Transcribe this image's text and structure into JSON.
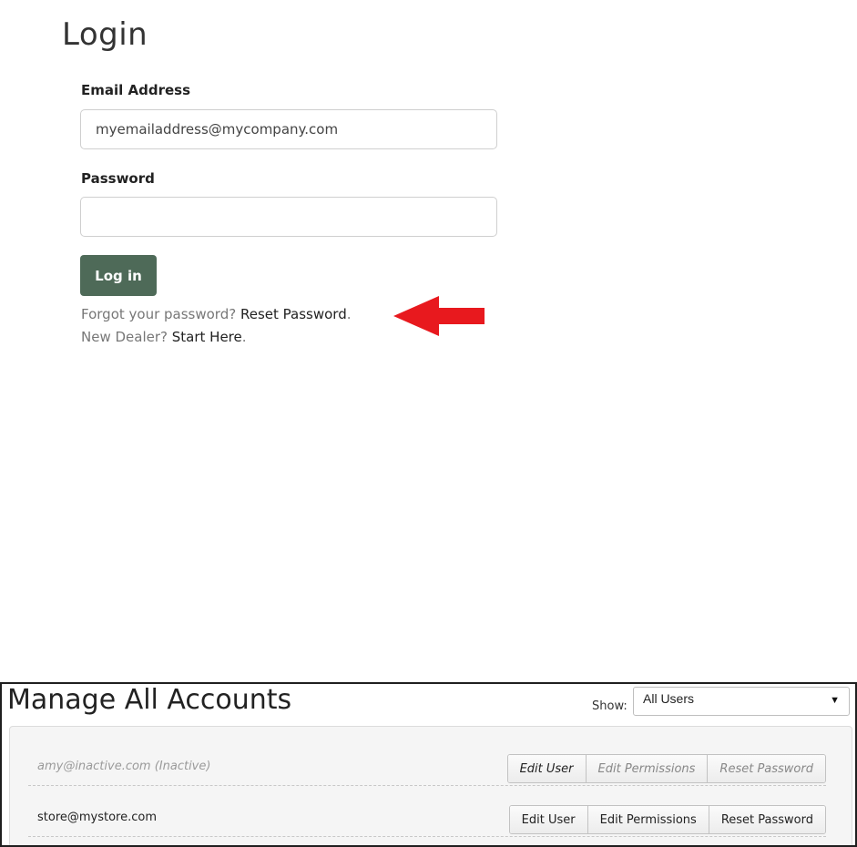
{
  "login": {
    "title": "Login",
    "email_label": "Email Address",
    "email_value": "myemailaddress@mycompany.com",
    "password_label": "Password",
    "password_value": "",
    "login_button": "Log in",
    "forgot_prefix": "Forgot your password?",
    "forgot_link": "Reset Password",
    "forgot_suffix": ".",
    "new_dealer_prefix": "New Dealer?",
    "new_dealer_link": "Start Here",
    "new_dealer_suffix": ".",
    "arrow_color": "#e8191e",
    "button_color": "#4e6a58"
  },
  "accounts": {
    "title": "Manage All Accounts",
    "show_label": "Show:",
    "show_value": "All Users",
    "rows": [
      {
        "email": "amy@inactive.com (Inactive)",
        "inactive": true,
        "edit_user": "Edit User",
        "edit_permissions": "Edit Permissions",
        "reset_password": "Reset Password"
      },
      {
        "email": "store@mystore.com",
        "inactive": false,
        "edit_user": "Edit User",
        "edit_permissions": "Edit Permissions",
        "reset_password": "Reset Password"
      }
    ]
  }
}
